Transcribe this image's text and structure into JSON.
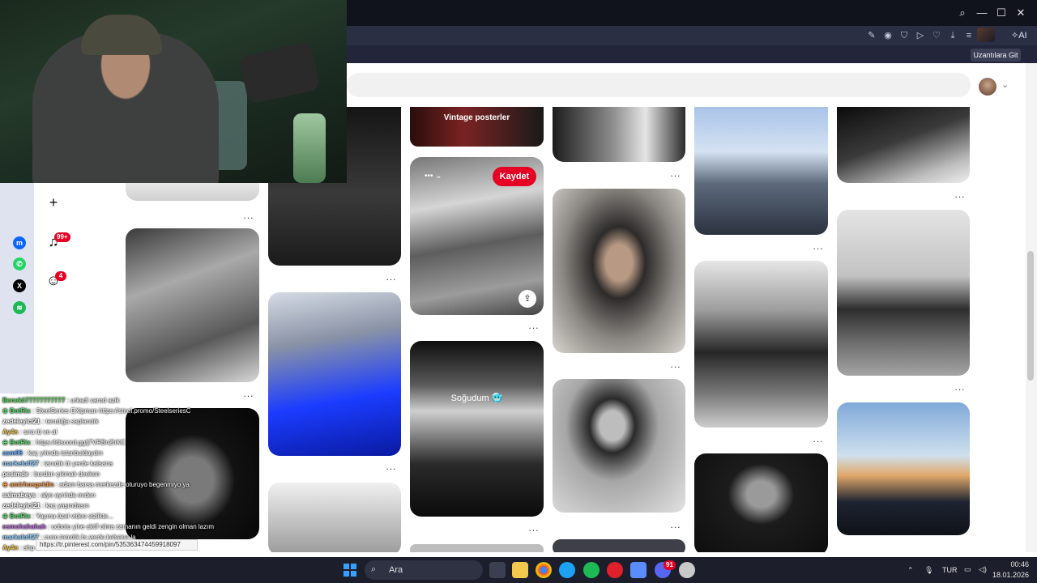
{
  "browser": {
    "extensions_tooltip": "Uzantılara Git",
    "ai_label": "AI",
    "window_controls": [
      "⌕",
      "—",
      "☐",
      "✕"
    ],
    "toolbar_icons": [
      "edit-icon",
      "camera-icon",
      "shield-icon",
      "play-icon",
      "heart-icon",
      "download-icon",
      "menu-icon"
    ]
  },
  "app": {
    "rail": {
      "create_icon": "+",
      "notifications_badge": "99+",
      "messages_badge": "4"
    }
  },
  "pins": {
    "vintage_title": "Vintage posterler",
    "save_label": "Kaydet",
    "sogudum_title": "Soğudum 🥶",
    "more_label": "..."
  },
  "chat": {
    "lines": [
      {
        "user": "Benekli77777777777",
        "text": " : urkadi xarod azik",
        "color": "#5ad65a"
      },
      {
        "user": "⊕ BotRix",
        "text": " : SteelSeries EXipman https://steel.promo/SteelseriesC",
        "color": "#58d66e"
      },
      {
        "user": "zedeleyici21",
        "text": " : tanıdığa saplandık",
        "color": "#ffffff"
      },
      {
        "user": "Ay4n",
        "text": " : sıra tü ve al",
        "color": "#f2c94c"
      },
      {
        "user": "⊕ BotRix",
        "text": " : https://discord.gg/j7VRBn2hKC",
        "color": "#58d66e"
      },
      {
        "user": "asm06",
        "text": " : kaç yılında istanbuldaydın",
        "color": "#5fb0ff"
      },
      {
        "user": "markeloff27",
        "text": " : tanıdık bi yerde kalsana",
        "color": "#8ad0ff"
      },
      {
        "user": "pesimde",
        "text": " : burdan çıkmalı deeken",
        "color": "#ffffff"
      },
      {
        "user": "⊕ amirhosgeldin",
        "text": " : adam barsa merkezde oturuyo begenmiyo ya",
        "color": "#f2994a"
      },
      {
        "user": "salmabeys",
        "text": " : alye ayrılıda evden",
        "color": "#ffffff"
      },
      {
        "user": "zedeleyici21",
        "text": " : kaç yaşındasın",
        "color": "#ffffff"
      },
      {
        "user": "⊕ BotRix",
        "text": " : Yayına özel video sizlikte...",
        "color": "#58d66e"
      },
      {
        "user": "esmohahahah",
        "text": " : ucbotu yine aktif olma zamanın geldi zengin olman lazım",
        "color": "#bb6bd9"
      },
      {
        "user": "markeloff27",
        "text": " : cuno tanıdık bı yerde kalsana la",
        "color": "#8ad0ff"
      },
      {
        "user": "Ay4n",
        "text": " : ahp ama",
        "color": "#f2c94c"
      }
    ],
    "url_tooltip": "https://tr.pinterest.com/pin/535363474459918097"
  },
  "taskbar": {
    "search_placeholder": "Ara",
    "language": "TUR",
    "time": "00:46",
    "date": "18.01.2026",
    "discord_badge": "91"
  },
  "colors": {
    "accent_red": "#e60023",
    "titlebar": "#11131c",
    "toolbar": "#2b2f44",
    "taskbar": "#1c1f2b"
  }
}
